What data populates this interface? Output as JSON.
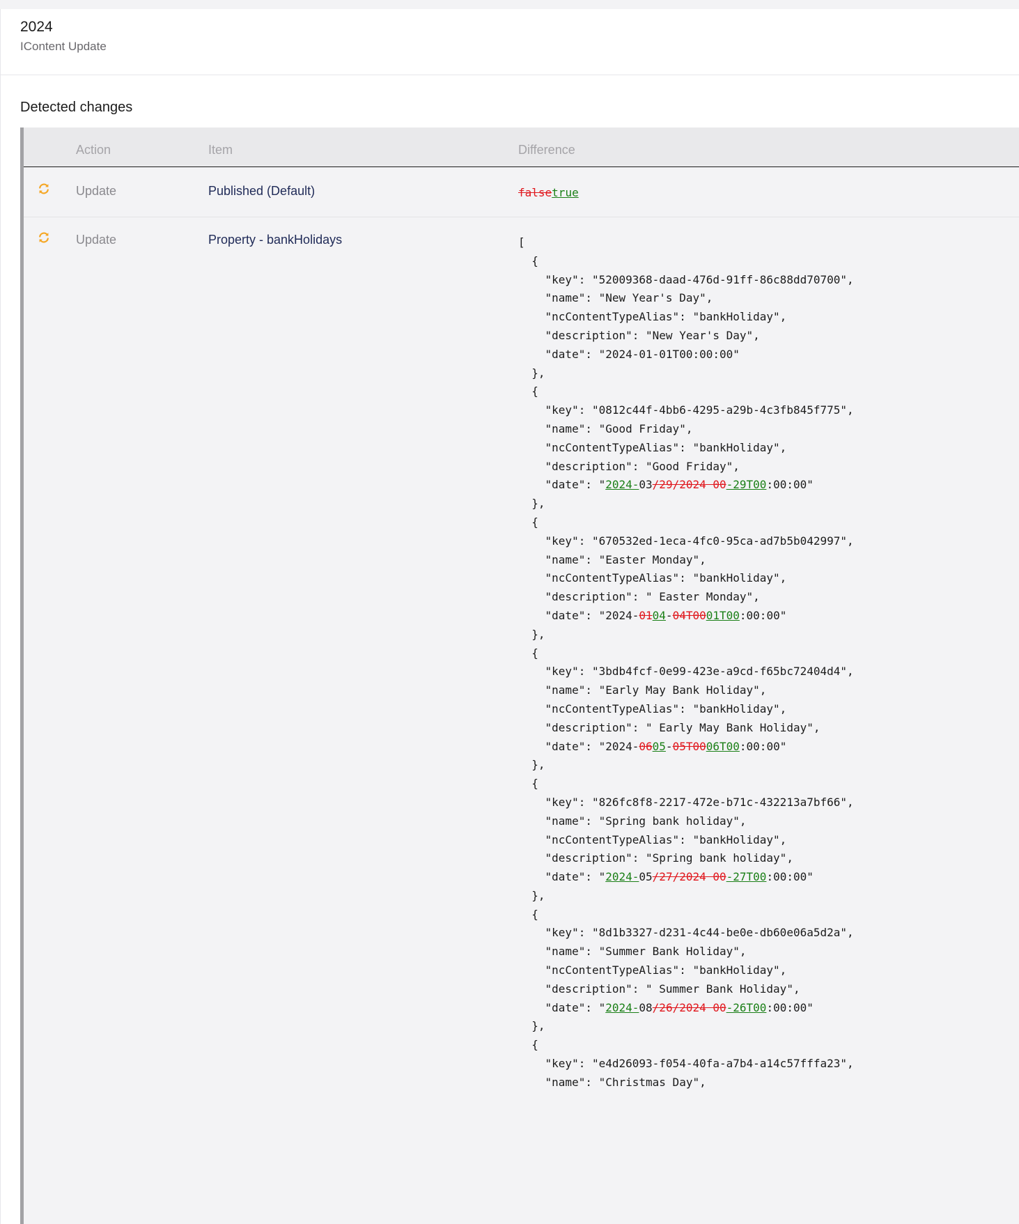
{
  "header": {
    "title": "2024",
    "subtitle": "IContent Update"
  },
  "section_title": "Detected changes",
  "table": {
    "columns": {
      "action": "Action",
      "item": "Item",
      "difference": "Difference"
    },
    "rows": [
      {
        "action": "Update",
        "item": "Published (Default)",
        "diff_lines": [
          [
            {
              "t": "del",
              "v": "false"
            },
            {
              "t": "ins",
              "v": "true"
            }
          ]
        ]
      },
      {
        "action": "Update",
        "item": "Property - bankHolidays",
        "diff_lines": [
          [
            {
              "t": "eq",
              "v": "["
            }
          ],
          [
            {
              "t": "eq",
              "v": "  {"
            }
          ],
          [
            {
              "t": "eq",
              "v": "    \"key\": \"52009368-daad-476d-91ff-86c88dd70700\","
            }
          ],
          [
            {
              "t": "eq",
              "v": "    \"name\": \"New Year's Day\","
            }
          ],
          [
            {
              "t": "eq",
              "v": "    \"ncContentTypeAlias\": \"bankHoliday\","
            }
          ],
          [
            {
              "t": "eq",
              "v": "    \"description\": \"New Year's Day\","
            }
          ],
          [
            {
              "t": "eq",
              "v": "    \"date\": \"2024-01-01T00:00:00\""
            }
          ],
          [
            {
              "t": "eq",
              "v": "  },"
            }
          ],
          [
            {
              "t": "eq",
              "v": "  {"
            }
          ],
          [
            {
              "t": "eq",
              "v": "    \"key\": \"0812c44f-4bb6-4295-a29b-4c3fb845f775\","
            }
          ],
          [
            {
              "t": "eq",
              "v": "    \"name\": \"Good Friday\","
            }
          ],
          [
            {
              "t": "eq",
              "v": "    \"ncContentTypeAlias\": \"bankHoliday\","
            }
          ],
          [
            {
              "t": "eq",
              "v": "    \"description\": \"Good Friday\","
            }
          ],
          [
            {
              "t": "eq",
              "v": "    \"date\": \""
            },
            {
              "t": "ins",
              "v": "2024-"
            },
            {
              "t": "eq",
              "v": "03"
            },
            {
              "t": "del",
              "v": "/29/2024 00"
            },
            {
              "t": "ins",
              "v": "-29T00"
            },
            {
              "t": "eq",
              "v": ":00:00\""
            }
          ],
          [
            {
              "t": "eq",
              "v": "  },"
            }
          ],
          [
            {
              "t": "eq",
              "v": "  {"
            }
          ],
          [
            {
              "t": "eq",
              "v": "    \"key\": \"670532ed-1eca-4fc0-95ca-ad7b5b042997\","
            }
          ],
          [
            {
              "t": "eq",
              "v": "    \"name\": \"Easter Monday\","
            }
          ],
          [
            {
              "t": "eq",
              "v": "    \"ncContentTypeAlias\": \"bankHoliday\","
            }
          ],
          [
            {
              "t": "eq",
              "v": "    \"description\": \" Easter Monday\","
            }
          ],
          [
            {
              "t": "eq",
              "v": "    \"date\": \"2024-"
            },
            {
              "t": "del",
              "v": "01"
            },
            {
              "t": "ins",
              "v": "04"
            },
            {
              "t": "eq",
              "v": "-"
            },
            {
              "t": "del",
              "v": "04T00"
            },
            {
              "t": "ins",
              "v": "01T00"
            },
            {
              "t": "eq",
              "v": ":00:00\""
            }
          ],
          [
            {
              "t": "eq",
              "v": "  },"
            }
          ],
          [
            {
              "t": "eq",
              "v": "  {"
            }
          ],
          [
            {
              "t": "eq",
              "v": "    \"key\": \"3bdb4fcf-0e99-423e-a9cd-f65bc72404d4\","
            }
          ],
          [
            {
              "t": "eq",
              "v": "    \"name\": \"Early May Bank Holiday\","
            }
          ],
          [
            {
              "t": "eq",
              "v": "    \"ncContentTypeAlias\": \"bankHoliday\","
            }
          ],
          [
            {
              "t": "eq",
              "v": "    \"description\": \" Early May Bank Holiday\","
            }
          ],
          [
            {
              "t": "eq",
              "v": "    \"date\": \"2024-"
            },
            {
              "t": "del",
              "v": "06"
            },
            {
              "t": "ins",
              "v": "05"
            },
            {
              "t": "eq",
              "v": "-"
            },
            {
              "t": "del",
              "v": "05T00"
            },
            {
              "t": "ins",
              "v": "06T00"
            },
            {
              "t": "eq",
              "v": ":00:00\""
            }
          ],
          [
            {
              "t": "eq",
              "v": "  },"
            }
          ],
          [
            {
              "t": "eq",
              "v": "  {"
            }
          ],
          [
            {
              "t": "eq",
              "v": "    \"key\": \"826fc8f8-2217-472e-b71c-432213a7bf66\","
            }
          ],
          [
            {
              "t": "eq",
              "v": "    \"name\": \"Spring bank holiday\","
            }
          ],
          [
            {
              "t": "eq",
              "v": "    \"ncContentTypeAlias\": \"bankHoliday\","
            }
          ],
          [
            {
              "t": "eq",
              "v": "    \"description\": \"Spring bank holiday\","
            }
          ],
          [
            {
              "t": "eq",
              "v": "    \"date\": \""
            },
            {
              "t": "ins",
              "v": "2024-"
            },
            {
              "t": "eq",
              "v": "05"
            },
            {
              "t": "del",
              "v": "/27/2024 00"
            },
            {
              "t": "ins",
              "v": "-27T00"
            },
            {
              "t": "eq",
              "v": ":00:00\""
            }
          ],
          [
            {
              "t": "eq",
              "v": "  },"
            }
          ],
          [
            {
              "t": "eq",
              "v": "  {"
            }
          ],
          [
            {
              "t": "eq",
              "v": "    \"key\": \"8d1b3327-d231-4c44-be0e-db60e06a5d2a\","
            }
          ],
          [
            {
              "t": "eq",
              "v": "    \"name\": \"Summer Bank Holiday\","
            }
          ],
          [
            {
              "t": "eq",
              "v": "    \"ncContentTypeAlias\": \"bankHoliday\","
            }
          ],
          [
            {
              "t": "eq",
              "v": "    \"description\": \" Summer Bank Holiday\","
            }
          ],
          [
            {
              "t": "eq",
              "v": "    \"date\": \""
            },
            {
              "t": "ins",
              "v": "2024-"
            },
            {
              "t": "eq",
              "v": "08"
            },
            {
              "t": "del",
              "v": "/26/2024 00"
            },
            {
              "t": "ins",
              "v": "-26T00"
            },
            {
              "t": "eq",
              "v": ":00:00\""
            }
          ],
          [
            {
              "t": "eq",
              "v": "  },"
            }
          ],
          [
            {
              "t": "eq",
              "v": "  {"
            }
          ],
          [
            {
              "t": "eq",
              "v": "    \"key\": \"e4d26093-f054-40fa-a7b4-a14c57fffa23\","
            }
          ],
          [
            {
              "t": "eq",
              "v": "    \"name\": \"Christmas Day\","
            }
          ]
        ]
      }
    ]
  },
  "icons": {
    "update": "sync-icon"
  },
  "colors": {
    "update_icon": "#f5a623",
    "deleted": "#e0171d",
    "inserted": "#1a7f16"
  }
}
